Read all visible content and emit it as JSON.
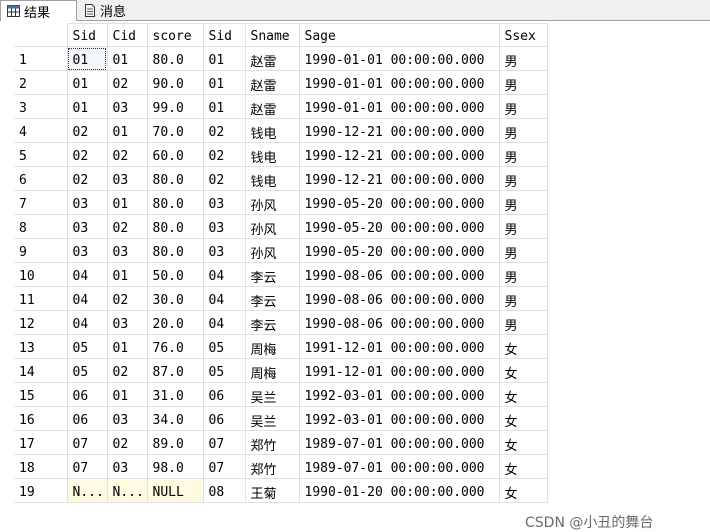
{
  "tabs": [
    {
      "label": "结果",
      "icon": "grid-icon",
      "active": true
    },
    {
      "label": "消息",
      "icon": "messages-icon",
      "active": false
    }
  ],
  "columns": [
    "Sid",
    "Cid",
    "score",
    "Sid",
    "Sname",
    "Sage",
    "Ssex"
  ],
  "rows": [
    {
      "n": "1",
      "c": [
        "01",
        "01",
        "80.0",
        "01",
        "赵雷",
        "1990-01-01 00:00:00.000",
        "男"
      ]
    },
    {
      "n": "2",
      "c": [
        "01",
        "02",
        "90.0",
        "01",
        "赵雷",
        "1990-01-01 00:00:00.000",
        "男"
      ]
    },
    {
      "n": "3",
      "c": [
        "01",
        "03",
        "99.0",
        "01",
        "赵雷",
        "1990-01-01 00:00:00.000",
        "男"
      ]
    },
    {
      "n": "4",
      "c": [
        "02",
        "01",
        "70.0",
        "02",
        "钱电",
        "1990-12-21 00:00:00.000",
        "男"
      ]
    },
    {
      "n": "5",
      "c": [
        "02",
        "02",
        "60.0",
        "02",
        "钱电",
        "1990-12-21 00:00:00.000",
        "男"
      ]
    },
    {
      "n": "6",
      "c": [
        "02",
        "03",
        "80.0",
        "02",
        "钱电",
        "1990-12-21 00:00:00.000",
        "男"
      ]
    },
    {
      "n": "7",
      "c": [
        "03",
        "01",
        "80.0",
        "03",
        "孙风",
        "1990-05-20 00:00:00.000",
        "男"
      ]
    },
    {
      "n": "8",
      "c": [
        "03",
        "02",
        "80.0",
        "03",
        "孙风",
        "1990-05-20 00:00:00.000",
        "男"
      ]
    },
    {
      "n": "9",
      "c": [
        "03",
        "03",
        "80.0",
        "03",
        "孙风",
        "1990-05-20 00:00:00.000",
        "男"
      ]
    },
    {
      "n": "10",
      "c": [
        "04",
        "01",
        "50.0",
        "04",
        "李云",
        "1990-08-06 00:00:00.000",
        "男"
      ]
    },
    {
      "n": "11",
      "c": [
        "04",
        "02",
        "30.0",
        "04",
        "李云",
        "1990-08-06 00:00:00.000",
        "男"
      ]
    },
    {
      "n": "12",
      "c": [
        "04",
        "03",
        "20.0",
        "04",
        "李云",
        "1990-08-06 00:00:00.000",
        "男"
      ]
    },
    {
      "n": "13",
      "c": [
        "05",
        "01",
        "76.0",
        "05",
        "周梅",
        "1991-12-01 00:00:00.000",
        "女"
      ]
    },
    {
      "n": "14",
      "c": [
        "05",
        "02",
        "87.0",
        "05",
        "周梅",
        "1991-12-01 00:00:00.000",
        "女"
      ]
    },
    {
      "n": "15",
      "c": [
        "06",
        "01",
        "31.0",
        "06",
        "吴兰",
        "1992-03-01 00:00:00.000",
        "女"
      ]
    },
    {
      "n": "16",
      "c": [
        "06",
        "03",
        "34.0",
        "06",
        "吴兰",
        "1992-03-01 00:00:00.000",
        "女"
      ]
    },
    {
      "n": "17",
      "c": [
        "07",
        "02",
        "89.0",
        "07",
        "郑竹",
        "1989-07-01 00:00:00.000",
        "女"
      ]
    },
    {
      "n": "18",
      "c": [
        "07",
        "03",
        "98.0",
        "07",
        "郑竹",
        "1989-07-01 00:00:00.000",
        "女"
      ]
    },
    {
      "n": "19",
      "c": [
        "N...",
        "N...",
        "NULL",
        "08",
        "王菊",
        "1990-01-20 00:00:00.000",
        "女"
      ]
    }
  ],
  "watermark": "CSDN @小丑的舞台",
  "colors": {
    "null_cell": "#fffbe0",
    "grid_line": "#e0e0e0"
  }
}
